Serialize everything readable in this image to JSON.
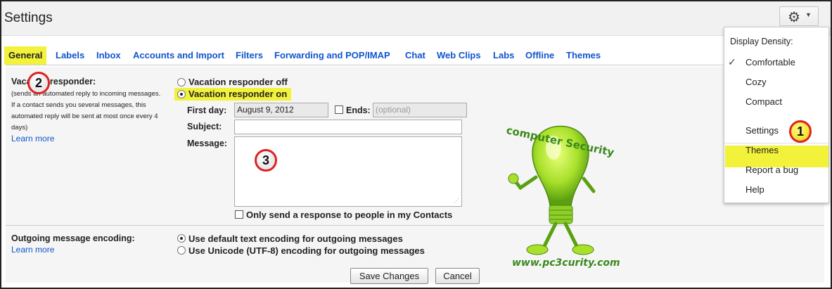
{
  "header": {
    "title": "Settings",
    "gear_icon": "gear-icon",
    "caret_icon": "chevron-down-icon"
  },
  "tabs": [
    {
      "label": "General",
      "active": true
    },
    {
      "label": "Labels"
    },
    {
      "label": "Inbox"
    },
    {
      "label": "Accounts and Import"
    },
    {
      "label": "Filters"
    },
    {
      "label": "Forwarding and POP/IMAP"
    },
    {
      "label": "Chat"
    },
    {
      "label": "Web Clips"
    },
    {
      "label": "Labs"
    },
    {
      "label": "Offline"
    },
    {
      "label": "Themes"
    }
  ],
  "vacation": {
    "title": "Vacation responder:",
    "desc_line1": "(sends an automated reply to incoming messages.",
    "desc_line2": "If a contact sends you several messages, this",
    "desc_line3": "automated reply will be sent at most once every 4",
    "desc_line4": "days)",
    "learn_more": "Learn more",
    "off_label": "Vacation responder off",
    "on_label": "Vacation responder on",
    "selected": "on",
    "first_day_label": "First day:",
    "first_day_value": "August 9, 2012",
    "ends_label": "Ends:",
    "ends_placeholder": "(optional)",
    "subject_label": "Subject:",
    "subject_value": "",
    "message_label": "Message:",
    "contacts_only_label": "Only send a response to people in my Contacts"
  },
  "encoding": {
    "title": "Outgoing message encoding:",
    "learn_more": "Learn more",
    "default_label": "Use default text encoding for outgoing messages",
    "unicode_label": "Use Unicode (UTF-8) encoding for outgoing messages",
    "selected": "default"
  },
  "buttons": {
    "save": "Save Changes",
    "cancel": "Cancel"
  },
  "dropdown": {
    "heading": "Display Density:",
    "density": [
      "Comfortable",
      "Cozy",
      "Compact"
    ],
    "selected_density": "Comfortable",
    "items": [
      "Settings",
      "Themes",
      "Report a bug",
      "Help"
    ],
    "highlighted": "Settings"
  },
  "annotations": {
    "badge1": "1",
    "badge2": "2",
    "badge3": "3"
  },
  "watermark": {
    "top_text": "computer Security",
    "url": "www.pc3curity.com"
  },
  "colors": {
    "highlight": "#f2f23a",
    "link": "#1155cc",
    "badge_border": "#dd2222",
    "watermark": "#3a8a1c"
  }
}
